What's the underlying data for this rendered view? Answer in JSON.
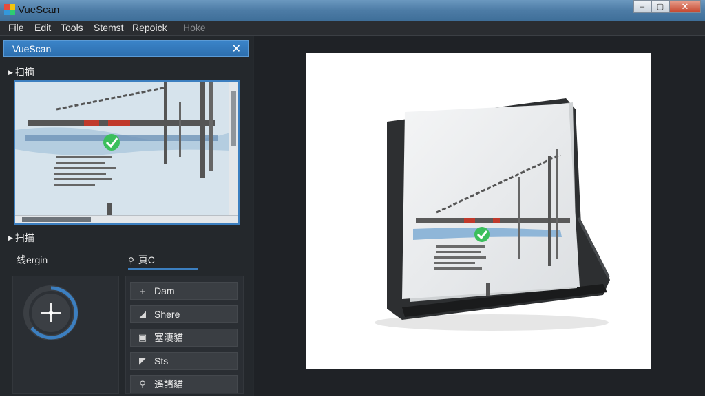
{
  "window": {
    "title": "VueScan",
    "controls": {
      "minimize": "–",
      "maximize": "▢",
      "close": "✕"
    }
  },
  "menu": {
    "items": [
      "File",
      "Edit",
      "Tools",
      "Stemst",
      "Repoick"
    ],
    "disabled_item": "Hoke"
  },
  "panel": {
    "title": "VueScan",
    "close": "✕",
    "section1": "扫摘",
    "section2": "扫描",
    "dial_label": "线ergin",
    "tab_label": "頁C",
    "actions": [
      {
        "icon": "plus-icon",
        "glyph": "+",
        "label": "Dam"
      },
      {
        "icon": "share-icon",
        "glyph": "◢",
        "label": "Shere"
      },
      {
        "icon": "document-icon",
        "glyph": "▣",
        "label": "塞淒貓"
      },
      {
        "icon": "triangle-icon",
        "glyph": "◤",
        "label": "Sts"
      },
      {
        "icon": "search-icon",
        "glyph": "⚲",
        "label": "遙諸貓"
      }
    ]
  },
  "colors": {
    "accent": "#3c7fc0",
    "check": "#3bbf5c",
    "bar_red": "#c0392b",
    "bar_blue": "#6fa8d6"
  }
}
